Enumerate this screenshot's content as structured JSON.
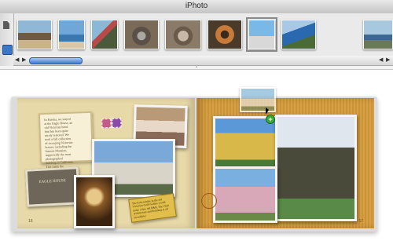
{
  "window": {
    "title": "iPhoto"
  },
  "sidebar": {
    "document_icon": "document-icon",
    "photos_icon": "photo-browser-icon"
  },
  "photo_browser": {
    "thumbnails": [
      {
        "name": "thumb-driftwood-beach",
        "selected": false
      },
      {
        "name": "thumb-person-shore",
        "selected": false
      },
      {
        "name": "thumb-person-cliff",
        "selected": false
      },
      {
        "name": "thumb-rocks",
        "selected": false
      },
      {
        "name": "thumb-stacked-stones",
        "selected": false
      },
      {
        "name": "thumb-shell-wreath",
        "selected": false
      },
      {
        "name": "thumb-jumping-person",
        "selected": true
      },
      {
        "name": "thumb-coastline",
        "selected": false
      },
      {
        "name": "thumb-sea-view",
        "selected": false
      }
    ],
    "scroll_position": 0.08
  },
  "book": {
    "left_page": {
      "note_text": "In Eureka, we stayed at the Eagle House, an old Victorian hotel that has been quite nicely restored. We took a fall collection of sweeping Victorian houses, including the famous Mansion, supposedly the most photographed building in California. This made the pictures magical.",
      "plaque_text": "EAGLE HOUSE",
      "yellow_note_text": "The bath outside in the old Victorian Gold Gables would make a fine old B&B. The 1920 architecture and detailing is all incredible!",
      "page_number": "16"
    },
    "right_page": {
      "page_number": "17"
    }
  },
  "colors": {
    "accent": "#3b7bd0",
    "left_page": "#e8d9a8",
    "right_page": "#d49a3a",
    "add_badge": "#3aa838"
  }
}
